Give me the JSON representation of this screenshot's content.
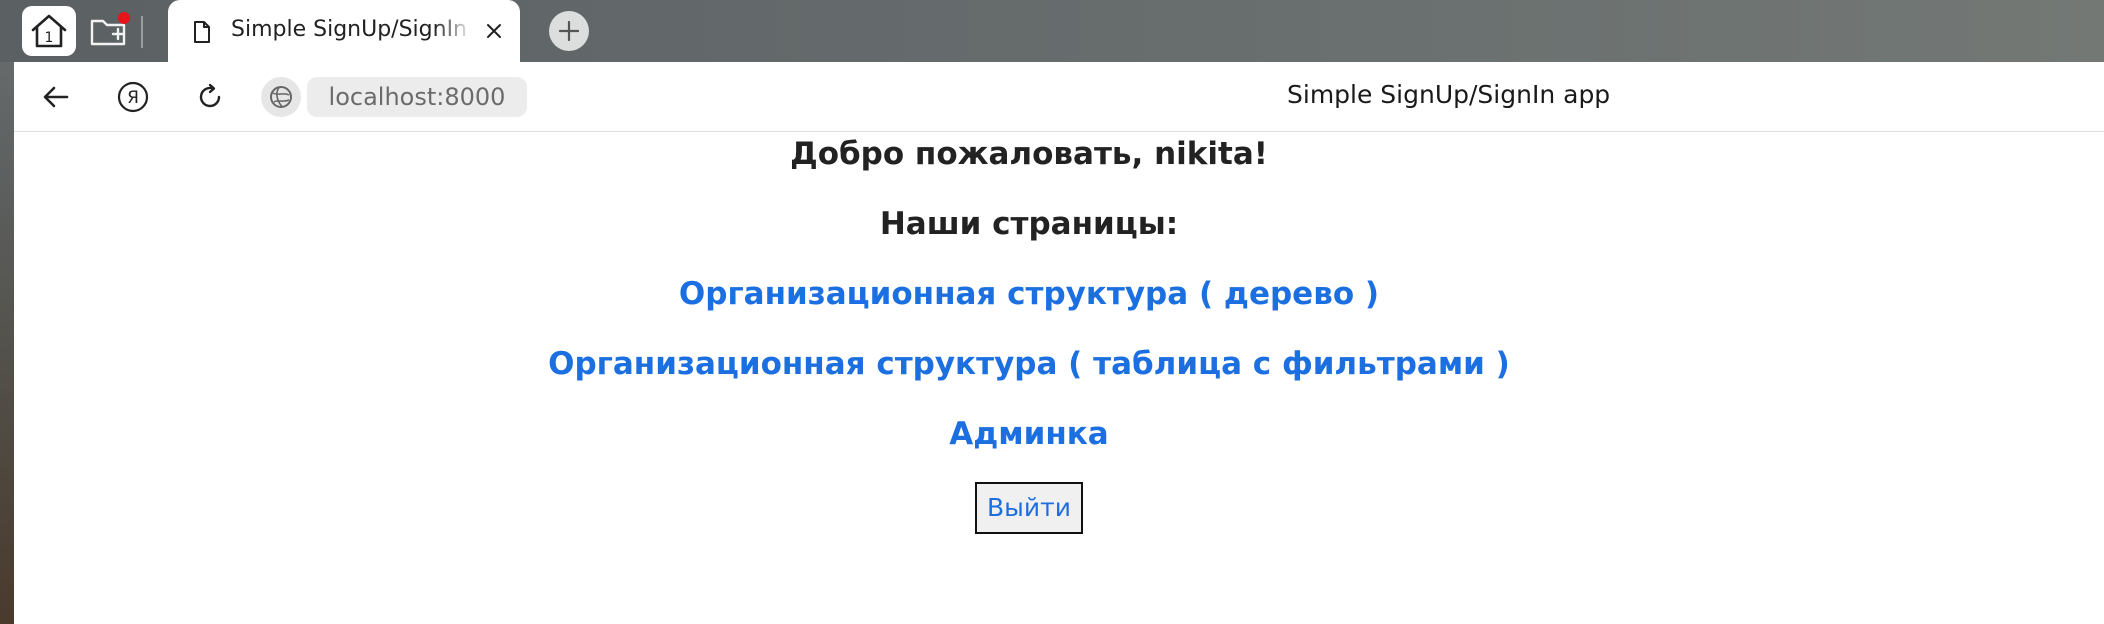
{
  "colors": {
    "link": "#1b6fe0",
    "heading": "#222222",
    "notification_dot": "#e8141c"
  },
  "browser": {
    "home_icon": "home-icon",
    "home_badge": "1",
    "folder_icon": "folder-add-icon",
    "tab": {
      "title": "Simple SignUp/SignIn app",
      "icon": "document-icon",
      "close_icon": "close-icon"
    },
    "new_tab_icon": "plus-icon",
    "nav": {
      "back_icon": "arrow-left-icon",
      "yandex_icon": "yandex-icon",
      "yandex_glyph": "Я",
      "reload_icon": "reload-icon",
      "site_info_icon": "globe-icon"
    },
    "url": "localhost:8000",
    "page_title": "Simple SignUp/SignIn app"
  },
  "page": {
    "welcome": "Добро пожаловать, nikita!",
    "pages_heading": "Наши страницы:",
    "links": [
      {
        "label": "Организационная структура ( дерево )"
      },
      {
        "label": "Организационная структура ( таблица с фильтрами )"
      },
      {
        "label": "Админка"
      }
    ],
    "logout_label": "Выйти"
  }
}
